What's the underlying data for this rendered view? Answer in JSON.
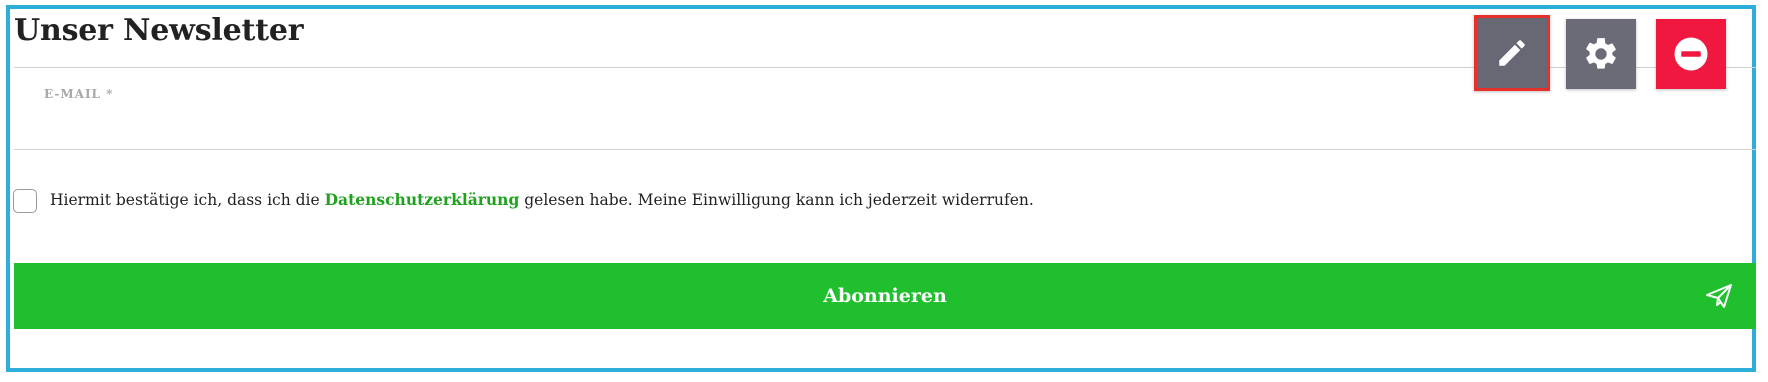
{
  "newsletter": {
    "title": "Unser Newsletter",
    "email_label": "E-MAIL *",
    "email_value": "",
    "consent_prefix": "Hiermit bestätige ich, dass ich die ",
    "consent_link": "Datenschutzerklärung",
    "consent_suffix": " gelesen habe. Meine Einwilligung kann ich jederzeit widerrufen.",
    "consent_checked": false,
    "submit_label": "Abonnieren"
  },
  "toolbar": {
    "buttons": [
      {
        "name": "edit",
        "icon": "pencil-icon",
        "color": "#676874",
        "selected": true
      },
      {
        "name": "settings",
        "icon": "gear-icon",
        "color": "#6a6b76",
        "selected": false
      },
      {
        "name": "remove",
        "icon": "minus-circle-icon",
        "color": "#f0183e",
        "selected": false
      }
    ]
  },
  "colors": {
    "frame_border": "#2eafd9",
    "accent_green": "#1fbf2d",
    "link_green": "#1fa31f",
    "selection_red": "#e8302a"
  }
}
